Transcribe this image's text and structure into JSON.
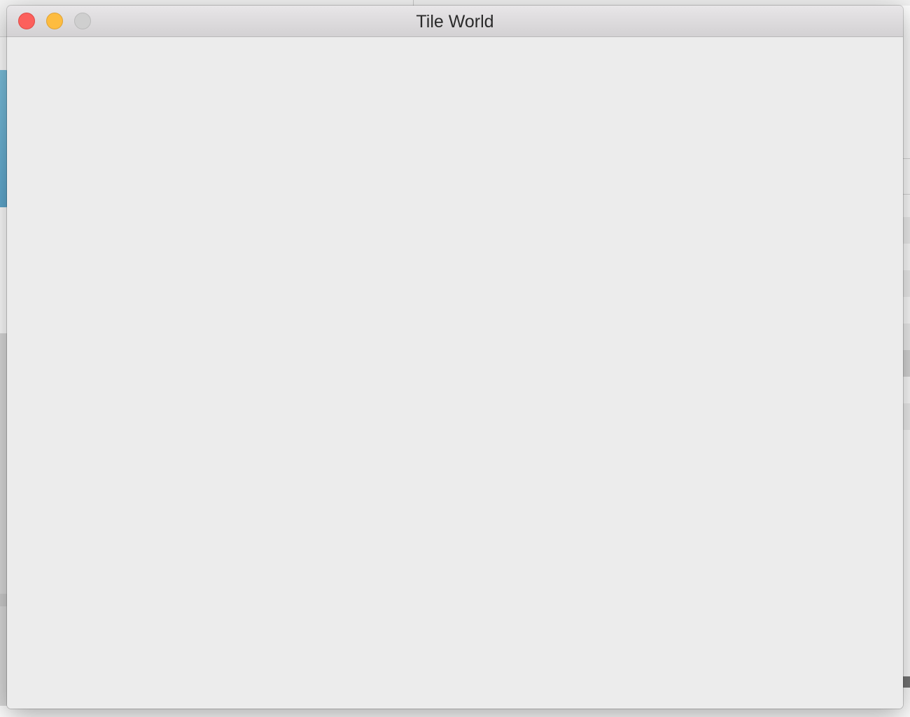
{
  "window": {
    "title": "Tile World"
  },
  "colors": {
    "close": "#fc605c",
    "minimize": "#fdbc40",
    "zoom": "#cfcfcf",
    "content_background": "#ececec"
  },
  "icons": {
    "close": "close-icon",
    "minimize": "minimize-icon",
    "zoom": "zoom-icon"
  }
}
